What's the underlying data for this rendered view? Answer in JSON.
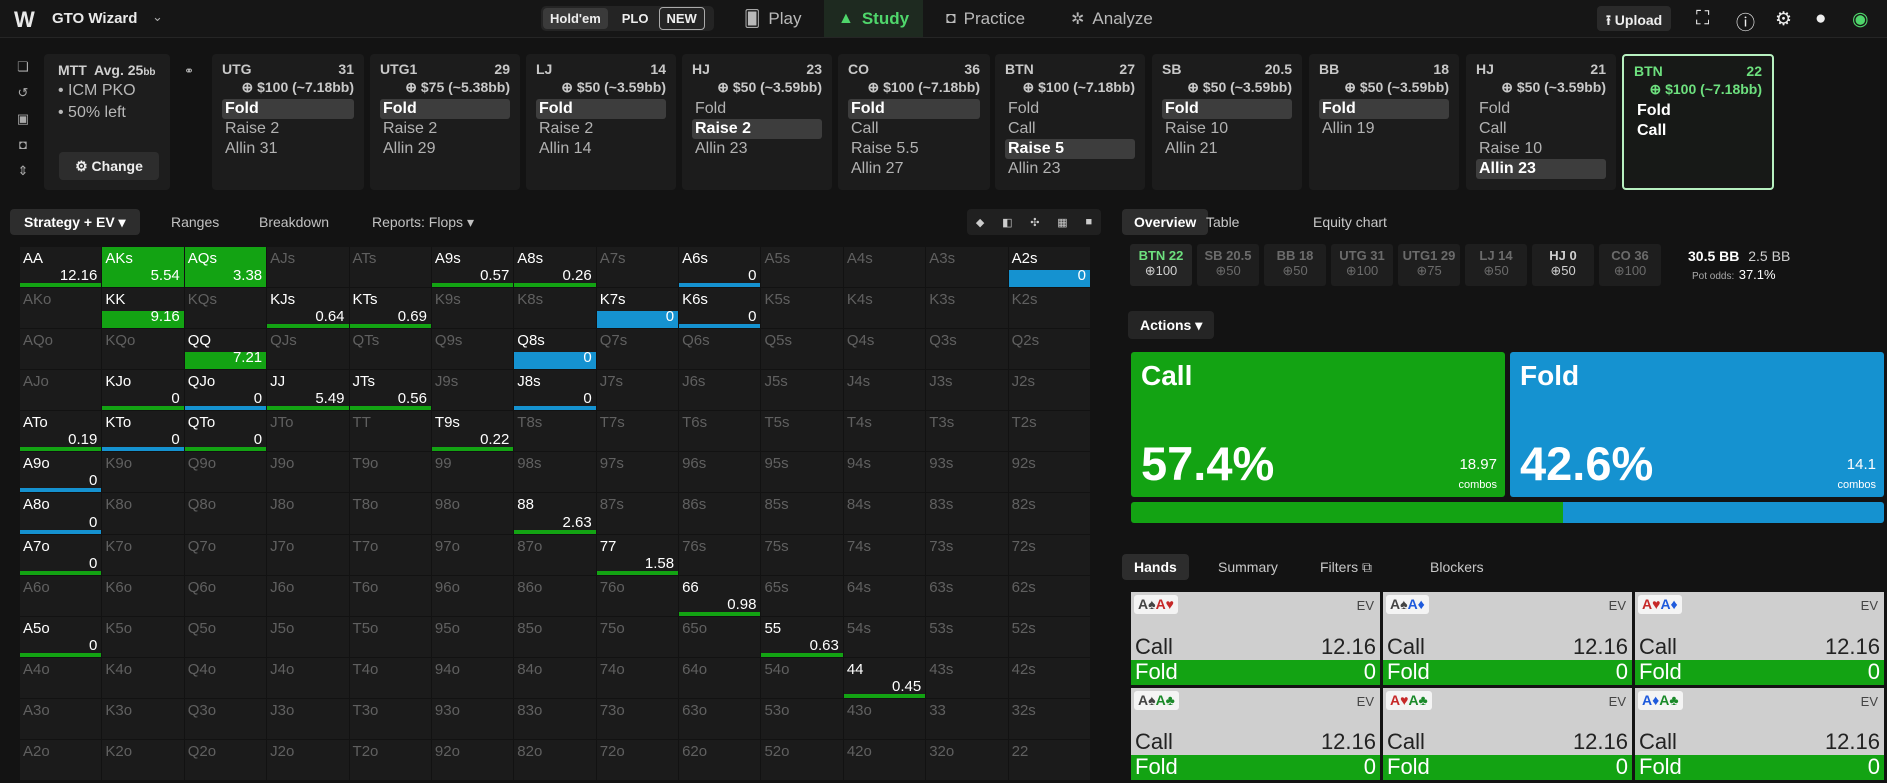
{
  "nav": {
    "brand": "GTO Wizard",
    "holdem": "Hold'em",
    "plo": "PLO",
    "new_badge": "NEW",
    "play": "Play",
    "study": "Study",
    "practice": "Practice",
    "analyze": "Analyze",
    "upload": "Upload"
  },
  "mtt": {
    "title": "MTT",
    "avg": "Avg. 25",
    "bb": "bb",
    "line1": "ICM PKO",
    "line2": "50% left",
    "change": "Change"
  },
  "players": [
    {
      "pos": "UTG",
      "stack": "31",
      "bet": "$100 (~7.18bb)",
      "actions": [
        "Fold",
        "Raise 2",
        "Allin 31"
      ],
      "sel": 0
    },
    {
      "pos": "UTG1",
      "stack": "29",
      "bet": "$75 (~5.38bb)",
      "actions": [
        "Fold",
        "Raise 2",
        "Allin 29"
      ],
      "sel": 0
    },
    {
      "pos": "LJ",
      "stack": "14",
      "bet": "$50 (~3.59bb)",
      "actions": [
        "Fold",
        "Raise 2",
        "Allin 14"
      ],
      "sel": 0
    },
    {
      "pos": "HJ",
      "stack": "23",
      "bet": "$50 (~3.59bb)",
      "actions": [
        "Fold",
        "Raise 2",
        "Allin 23"
      ],
      "sel": 1
    },
    {
      "pos": "CO",
      "stack": "36",
      "bet": "$100 (~7.18bb)",
      "actions": [
        "Fold",
        "Call",
        "Raise 5.5",
        "Allin 27"
      ],
      "sel": 0
    },
    {
      "pos": "BTN",
      "stack": "27",
      "bet": "$100 (~7.18bb)",
      "actions": [
        "Fold",
        "Call",
        "Raise 5",
        "Allin 23"
      ],
      "sel": 2
    },
    {
      "pos": "SB",
      "stack": "20.5",
      "bet": "$50 (~3.59bb)",
      "actions": [
        "Fold",
        "Raise 10",
        "Allin 21"
      ],
      "sel": 0
    },
    {
      "pos": "BB",
      "stack": "18",
      "bet": "$50 (~3.59bb)",
      "actions": [
        "Fold",
        "Allin 19"
      ],
      "sel": 0
    },
    {
      "pos": "HJ",
      "stack": "21",
      "bet": "$50 (~3.59bb)",
      "actions": [
        "Fold",
        "Call",
        "Raise 10",
        "Allin 23"
      ],
      "sel": 3
    },
    {
      "pos": "BTN",
      "stack": "22",
      "bet": "$100 (~7.18bb)",
      "actions": [
        "Fold",
        "Call"
      ],
      "sel": -1
    }
  ],
  "left_tabs": {
    "strategy": "Strategy + EV",
    "ranges": "Ranges",
    "breakdown": "Breakdown",
    "reports": "Reports: Flops"
  },
  "grid": [
    [
      "AA",
      "AKs",
      "AQs",
      "AJs",
      "ATs",
      "A9s",
      "A8s",
      "A7s",
      "A6s",
      "A5s",
      "A4s",
      "A3s",
      "A2s"
    ],
    [
      "AKo",
      "KK",
      "KQs",
      "KJs",
      "KTs",
      "K9s",
      "K8s",
      "K7s",
      "K6s",
      "K5s",
      "K4s",
      "K3s",
      "K2s"
    ],
    [
      "AQo",
      "KQo",
      "QQ",
      "QJs",
      "QTs",
      "Q9s",
      "Q8s",
      "Q7s",
      "Q6s",
      "Q5s",
      "Q4s",
      "Q3s",
      "Q2s"
    ],
    [
      "AJo",
      "KJo",
      "QJo",
      "JJ",
      "JTs",
      "J9s",
      "J8s",
      "J7s",
      "J6s",
      "J5s",
      "J4s",
      "J3s",
      "J2s"
    ],
    [
      "ATo",
      "KTo",
      "QTo",
      "JTo",
      "TT",
      "T9s",
      "T8s",
      "T7s",
      "T6s",
      "T5s",
      "T4s",
      "T3s",
      "T2s"
    ],
    [
      "A9o",
      "K9o",
      "Q9o",
      "J9o",
      "T9o",
      "99",
      "98s",
      "97s",
      "96s",
      "95s",
      "94s",
      "93s",
      "92s"
    ],
    [
      "A8o",
      "K8o",
      "Q8o",
      "J8o",
      "T8o",
      "98o",
      "88",
      "87s",
      "86s",
      "85s",
      "84s",
      "83s",
      "82s"
    ],
    [
      "A7o",
      "K7o",
      "Q7o",
      "J7o",
      "T7o",
      "97o",
      "87o",
      "77",
      "76s",
      "75s",
      "74s",
      "73s",
      "72s"
    ],
    [
      "A6o",
      "K6o",
      "Q6o",
      "J6o",
      "T6o",
      "96o",
      "86o",
      "76o",
      "66",
      "65s",
      "64s",
      "63s",
      "62s"
    ],
    [
      "A5o",
      "K5o",
      "Q5o",
      "J5o",
      "T5o",
      "95o",
      "85o",
      "75o",
      "65o",
      "55",
      "54s",
      "53s",
      "52s"
    ],
    [
      "A4o",
      "K4o",
      "Q4o",
      "J4o",
      "T4o",
      "94o",
      "84o",
      "74o",
      "64o",
      "54o",
      "44",
      "43s",
      "42s"
    ],
    [
      "A3o",
      "K3o",
      "Q3o",
      "J3o",
      "T3o",
      "93o",
      "83o",
      "73o",
      "63o",
      "53o",
      "43o",
      "33",
      "32s"
    ],
    [
      "A2o",
      "K2o",
      "Q2o",
      "J2o",
      "T2o",
      "92o",
      "82o",
      "72o",
      "62o",
      "52o",
      "42o",
      "32o",
      "22"
    ]
  ],
  "evs": {
    "AA": "12.16",
    "AKs": "5.54",
    "AQs": "3.38",
    "A9s": "0.57",
    "A8s": "0.26",
    "A6s": "0",
    "A2s": "0",
    "KK": "9.16",
    "KJs": "0.64",
    "KTs": "0.69",
    "K7s": "0",
    "K6s": "0",
    "QQ": "7.21",
    "Q8s": "0",
    "KJo": "0",
    "QJo": "0",
    "JJ": "5.49",
    "JTs": "0.56",
    "J8s": "0",
    "ATo": "0.19",
    "KTo": "0",
    "QTo": "0",
    "T9s": "0.22",
    "A9o": "0",
    "A8o": "0",
    "88": "2.63",
    "A7o": "0",
    "77": "1.58",
    "66": "0.98",
    "A5o": "0",
    "55": "0.63",
    "44": "0.45"
  },
  "right_tabs": {
    "overview": "Overview",
    "table": "Table",
    "equity": "Equity chart"
  },
  "seats": [
    {
      "name": "BTN 22",
      "stack": "100",
      "state": "on"
    },
    {
      "name": "SB 20.5",
      "stack": "50",
      "state": ""
    },
    {
      "name": "BB 18",
      "stack": "50",
      "state": ""
    },
    {
      "name": "UTG 31",
      "stack": "100",
      "state": ""
    },
    {
      "name": "UTG1 29",
      "stack": "75",
      "state": ""
    },
    {
      "name": "LJ 14",
      "stack": "50",
      "state": ""
    },
    {
      "name": "HJ 0",
      "stack": "50",
      "state": "hj"
    },
    {
      "name": "CO 36",
      "stack": "100",
      "state": ""
    }
  ],
  "pot": {
    "bb": "30.5 BB",
    "bb2": "2.5 BB",
    "odds_label": "Pot odds:",
    "odds": "37.1%"
  },
  "actions_tab": "Actions",
  "actions": [
    {
      "name": "Call",
      "pct": "57.4%",
      "combos": "18.97",
      "combos_label": "combos",
      "color": "#13a313",
      "freq": 57.4
    },
    {
      "name": "Fold",
      "pct": "42.6%",
      "combos": "14.1",
      "combos_label": "combos",
      "color": "#1592d0",
      "freq": 42.6
    }
  ],
  "hands_tabs": {
    "hands": "Hands",
    "summary": "Summary",
    "filters": "Filters",
    "blockers": "Blockers"
  },
  "hands": [
    {
      "c1": "A♠",
      "s1": "cs",
      "c2": "A♥",
      "s2": "ch",
      "ev_label": "EV",
      "call": "Call",
      "call_ev": "12.16",
      "fold": "Fold",
      "fold_ev": "0"
    },
    {
      "c1": "A♠",
      "s1": "cs",
      "c2": "A♦",
      "s2": "cd",
      "ev_label": "EV",
      "call": "Call",
      "call_ev": "12.16",
      "fold": "Fold",
      "fold_ev": "0"
    },
    {
      "c1": "A♥",
      "s1": "ch",
      "c2": "A♦",
      "s2": "cd",
      "ev_label": "EV",
      "call": "Call",
      "call_ev": "12.16",
      "fold": "Fold",
      "fold_ev": "0"
    },
    {
      "c1": "A♠",
      "s1": "cs",
      "c2": "A♣",
      "s2": "cc",
      "ev_label": "EV",
      "call": "Call",
      "call_ev": "12.16",
      "fold": "Fold",
      "fold_ev": "0"
    },
    {
      "c1": "A♥",
      "s1": "ch",
      "c2": "A♣",
      "s2": "cc",
      "ev_label": "EV",
      "call": "Call",
      "call_ev": "12.16",
      "fold": "Fold",
      "fold_ev": "0"
    },
    {
      "c1": "A♦",
      "s1": "cd",
      "c2": "A♣",
      "s2": "cc",
      "ev_label": "EV",
      "call": "Call",
      "call_ev": "12.16",
      "fold": "Fold",
      "fold_ev": "0"
    }
  ]
}
